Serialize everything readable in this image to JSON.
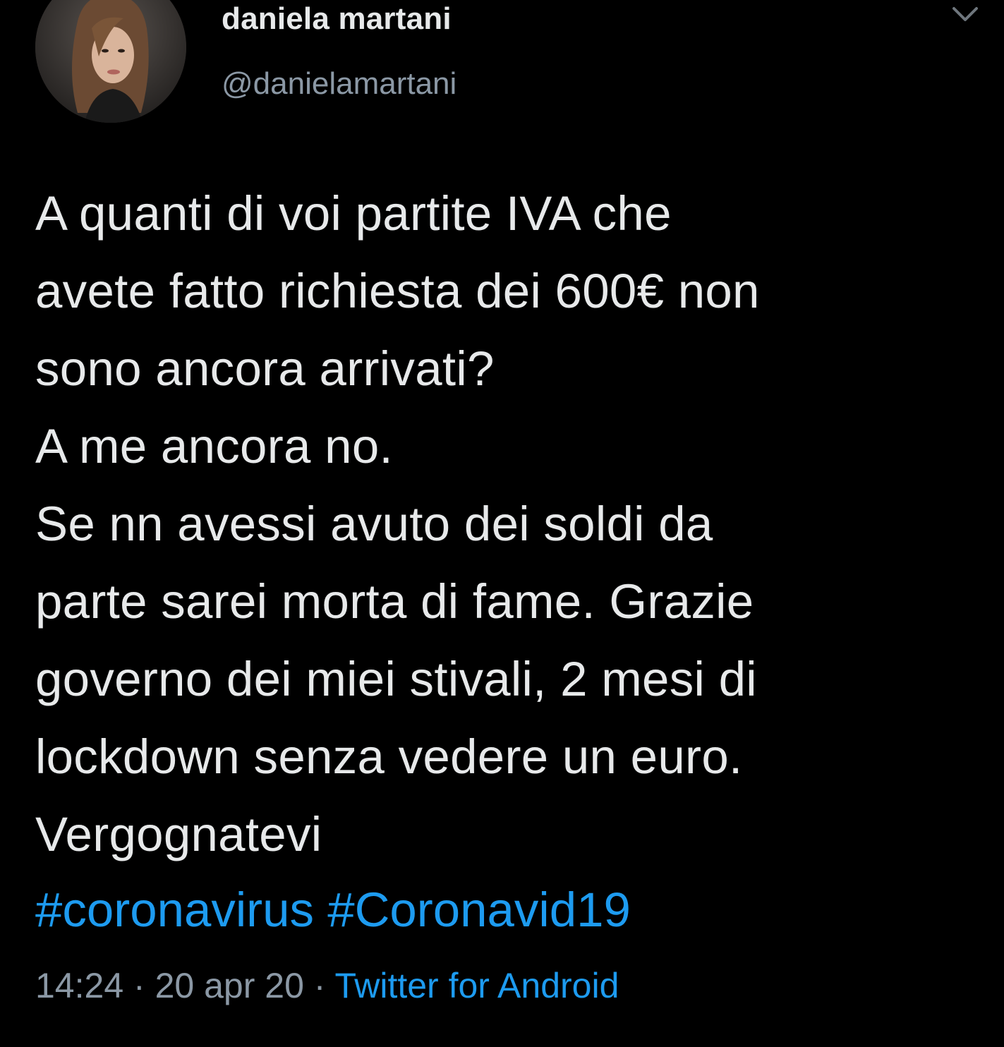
{
  "tweet": {
    "author": {
      "display_name": "daniela martani",
      "handle": "@danielamartani",
      "avatar_icon": "profile-photo"
    },
    "menu_icon": "chevron-down-icon",
    "text": "A quanti di voi partite IVA che\navete fatto richiesta dei 600€ non\nsono ancora arrivati?\nA me ancora no.\nSe nn avessi avuto dei soldi da\nparte sarei morta di fame. Grazie\ngoverno dei miei stivali, 2 mesi di\nlockdown senza vedere un euro.\nVergognatevi",
    "hashtags": [
      "#coronavirus",
      "#Coronavid19"
    ],
    "time": "14:24",
    "separator": "·",
    "date": "20 apr 20",
    "source": "Twitter for Android"
  },
  "colors": {
    "background": "#000000",
    "text": "#e7e9ea",
    "secondary": "#8b98a5",
    "link": "#1d9bf0"
  }
}
